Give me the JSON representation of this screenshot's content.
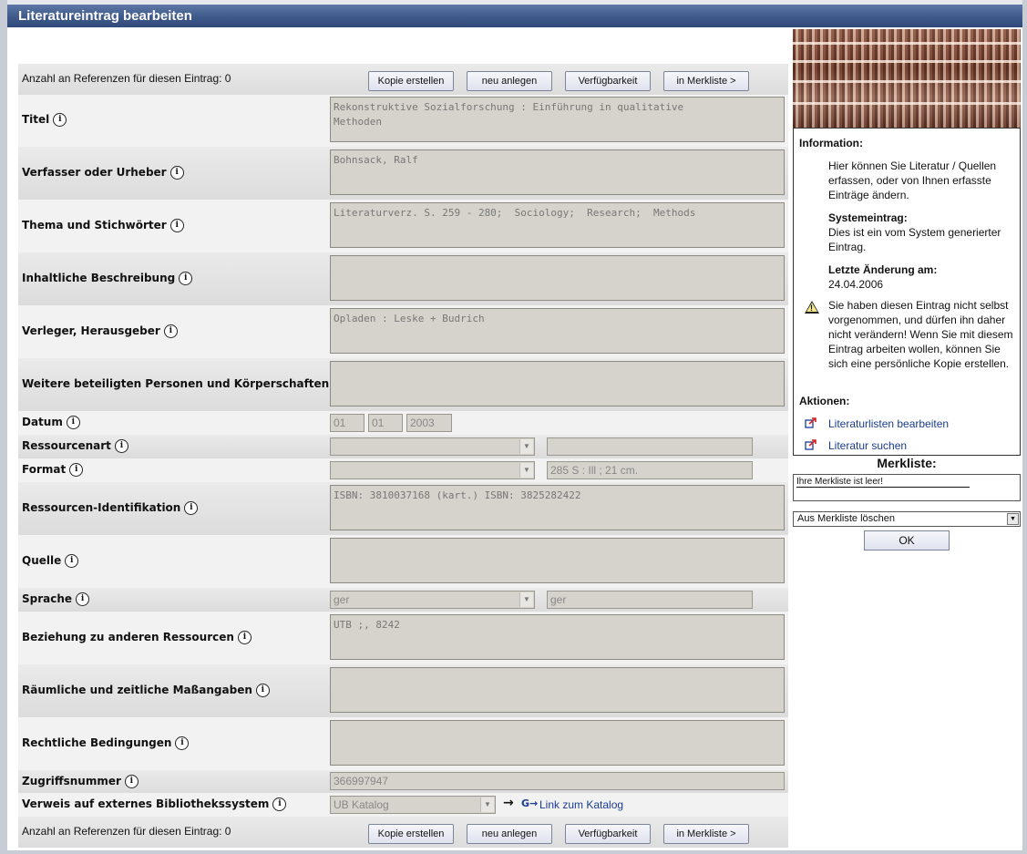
{
  "window": {
    "title": "Literatureintrag bearbeiten"
  },
  "top_bar": {
    "refs_text": "Anzahl an Referenzen für diesen Eintrag: 0",
    "buttons": {
      "copy": "Kopie erstellen",
      "new": "neu anlegen",
      "avail": "Verfügbarkeit",
      "merk": "in Merkliste  >"
    }
  },
  "fields": {
    "titel": {
      "label": "Titel",
      "value": "Rekonstruktive Sozialforschung : Einführung in qualitative\nMethoden"
    },
    "verfasser": {
      "label": "Verfasser oder Urheber",
      "value": "Bohnsack, Ralf"
    },
    "thema": {
      "label": "Thema und Stichwörter",
      "value": "Literaturverz. S. 259 - 280;  Sociology;  Research;  Methods"
    },
    "inhalt": {
      "label": "Inhaltliche Beschreibung",
      "value": ""
    },
    "verleger": {
      "label": "Verleger, Herausgeber",
      "value": "Opladen : Leske + Budrich"
    },
    "weitere": {
      "label": "Weitere beteiligten Personen und Körperschaften",
      "value": ""
    },
    "datum": {
      "label": "Datum",
      "day": "01",
      "month": "01",
      "year": "2003"
    },
    "ressourcenart": {
      "label": "Ressourcenart",
      "select": "",
      "text": ""
    },
    "format": {
      "label": "Format",
      "select": "",
      "text": "285 S : Ill ; 21 cm."
    },
    "identifikation": {
      "label": "Ressourcen-Identifikation",
      "value": "ISBN: 3810037168 (kart.) ISBN: 3825282422"
    },
    "quelle": {
      "label": "Quelle",
      "value": ""
    },
    "sprache": {
      "label": "Sprache",
      "select": "ger",
      "text": "ger"
    },
    "beziehung": {
      "label": "Beziehung zu anderen Ressourcen",
      "value": "UTB ;, 8242"
    },
    "raum": {
      "label": "Räumliche und zeitliche Maßangaben",
      "value": ""
    },
    "recht": {
      "label": "Rechtliche Bedingungen",
      "value": ""
    },
    "zugriff": {
      "label": "Zugriffsnummer",
      "value": "366997947"
    },
    "verweis": {
      "label": "Verweis auf externes Bibliothekssystem",
      "select": "UB Katalog",
      "arrow": "→",
      "link": "Link zum Katalog"
    }
  },
  "bottom_bar": {
    "refs_text": "Anzahl an Referenzen für diesen Eintrag: 0",
    "buttons": {
      "copy": "Kopie erstellen",
      "new": "neu anlegen",
      "avail": "Verfügbarkeit",
      "merk": "in Merkliste  >"
    }
  },
  "sidebar": {
    "info_heading": "Information:",
    "info_text": "Hier können Sie Literatur / Quellen erfassen, oder von Ihnen erfasste Einträge ändern.",
    "system_heading": "Systemeintrag:",
    "system_text": "Dies ist ein vom System generierter Eintrag.",
    "changed_heading": "Letzte Änderung am:",
    "changed_date": "24.04.2006",
    "warning_text": "Sie haben diesen Eintrag nicht selbst vorgenommen, und dürfen ihn daher nicht verändern! Wenn Sie mit diesem Eintrag arbeiten wollen, können Sie sich eine persönliche Kopie erstellen.",
    "actions_heading": "Aktionen:",
    "actions": [
      "Literaturlisten bearbeiten",
      "Literatur suchen"
    ],
    "merkliste_title": "Merkliste:",
    "merkliste_empty": "Ihre Merkliste ist leer!",
    "merkliste_select": "Aus Merkliste löschen",
    "ok": "OK"
  },
  "colors": {
    "titlebar": "#3f5a8a",
    "field_bg": "#d6d3cc",
    "link": "#1a3d8f"
  }
}
